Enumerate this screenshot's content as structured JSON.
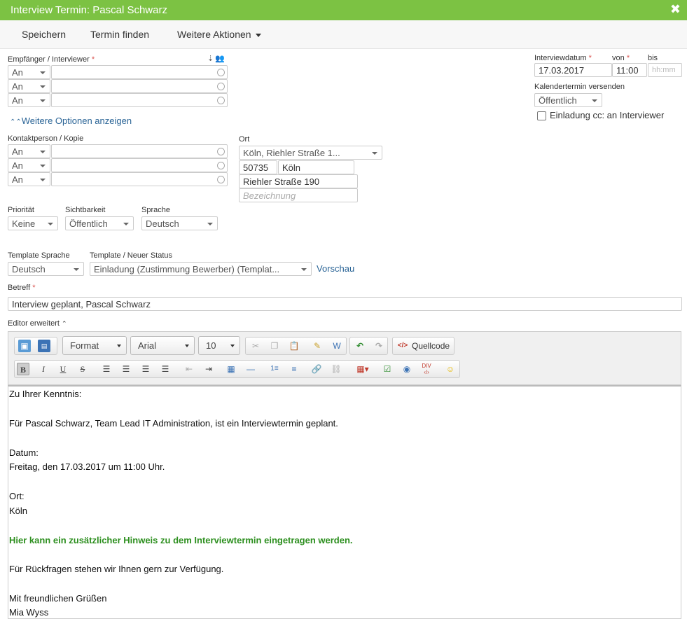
{
  "window": {
    "title": "Interview Termin: Pascal Schwarz"
  },
  "toolbar": {
    "save": "Speichern",
    "find_slot": "Termin finden",
    "more_actions": "Weitere Aktionen"
  },
  "recipients": {
    "label": "Empfänger / Interviewer",
    "required": "*",
    "rows": [
      {
        "type": "An",
        "value": ""
      },
      {
        "type": "An",
        "value": ""
      },
      {
        "type": "An",
        "value": ""
      }
    ]
  },
  "more_options": "Weitere Optionen anzeigen",
  "contact": {
    "label": "Kontaktperson / Kopie",
    "rows": [
      {
        "type": "An",
        "value": ""
      },
      {
        "type": "An",
        "value": ""
      },
      {
        "type": "An",
        "value": ""
      }
    ]
  },
  "location": {
    "label": "Ort",
    "selected": "Köln, Riehler Straße 1...",
    "zip": "50735",
    "city": "Köln",
    "street": "Riehler Straße 190",
    "designation_placeholder": "Bezeichnung"
  },
  "interview_date": {
    "label": "Interviewdatum",
    "value": "17.03.2017",
    "from_label": "von",
    "from_value": "11:00",
    "to_label": "bis",
    "to_placeholder": "hh:mm",
    "required": "*"
  },
  "calendar": {
    "label": "Kalendertermin versenden",
    "value": "Öffentlich",
    "cc_label": "Einladung cc: an Interviewer",
    "cc_checked": false
  },
  "priority": {
    "label": "Priorität",
    "value": "Keine"
  },
  "visibility": {
    "label": "Sichtbarkeit",
    "value": "Öffentlich"
  },
  "language": {
    "label": "Sprache",
    "value": "Deutsch"
  },
  "template_language": {
    "label": "Template Sprache",
    "value": "Deutsch"
  },
  "template": {
    "label": "Template / Neuer Status",
    "value": "Einladung (Zustimmung Bewerber) (Templat...",
    "preview": "Vorschau"
  },
  "subject": {
    "label": "Betreff",
    "required": "*",
    "value": "Interview geplant, Pascal  Schwarz"
  },
  "editor": {
    "label": "Editor erweitert",
    "format": "Format",
    "font": "Arial",
    "size": "10",
    "source": "Quellcode",
    "lines": [
      "Zu Ihrer Kenntnis:",
      "Für Pascal Schwarz, Team Lead IT Administration, ist ein Interviewtermin geplant.",
      "Datum:",
      "Freitag, den 17.03.2017 um 11:00 Uhr.",
      "Ort:",
      "Köln",
      "Hier kann ein zusätzlicher Hinweis zu dem Interviewtermin eingetragen werden.",
      "Für Rückfragen stehen wir Ihnen gern zur Verfügung.",
      "Mit freundlichen Grüßen",
      "Mia Wyss"
    ],
    "highlight_color": "#2d8f1f"
  },
  "colors": {
    "titlebar": "#7cc243",
    "link": "#2a6496",
    "required": "#d9534f"
  }
}
